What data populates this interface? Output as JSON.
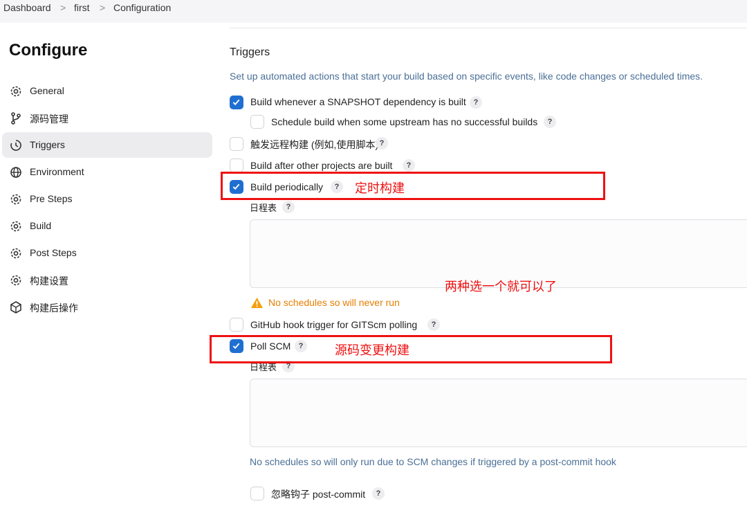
{
  "breadcrumb": {
    "items": [
      "Dashboard",
      "first",
      "Configuration"
    ],
    "separator": ">"
  },
  "page": {
    "title": "Configure"
  },
  "sidebar": {
    "items": [
      {
        "label": "General",
        "icon": "gear-icon",
        "active": false
      },
      {
        "label": "源码管理",
        "icon": "branch-icon",
        "active": false
      },
      {
        "label": "Triggers",
        "icon": "clock-icon",
        "active": true
      },
      {
        "label": "Environment",
        "icon": "globe-icon",
        "active": false
      },
      {
        "label": "Pre Steps",
        "icon": "gear-icon",
        "active": false
      },
      {
        "label": "Build",
        "icon": "gear-icon",
        "active": false
      },
      {
        "label": "Post Steps",
        "icon": "gear-icon",
        "active": false
      },
      {
        "label": "构建设置",
        "icon": "gear-icon",
        "active": false
      },
      {
        "label": "构建后操作",
        "icon": "package-icon",
        "active": false
      }
    ]
  },
  "triggers": {
    "title": "Triggers",
    "description": "Set up automated actions that start your build based on specific events, like code changes or scheduled times.",
    "options": [
      {
        "label": "Build whenever a SNAPSHOT dependency is built",
        "checked": true
      },
      {
        "label": "Schedule build when some upstream has no successful builds",
        "checked": false
      },
      {
        "label": "触发远程构建 (例如,使用脚本)",
        "checked": false
      },
      {
        "label": "Build after other projects are built",
        "checked": false
      },
      {
        "label": "Build periodically",
        "checked": true
      },
      {
        "label": "GitHub hook trigger for GITScm polling",
        "checked": false
      },
      {
        "label": "Poll SCM",
        "checked": true
      },
      {
        "label": "忽略钩子 post-commit",
        "checked": false
      }
    ],
    "help_symbol": "?",
    "schedule_label": "日程表",
    "schedule_value": "",
    "poll_schedule_value": "",
    "warning": "No schedules so will never run",
    "poll_info": "No schedules so will only run due to SCM changes if triggered by a post-commit hook"
  },
  "annotations": {
    "periodic": "定时构建",
    "choose_one": "两种选一个就可以了",
    "scm": "源码变更构建"
  },
  "colors": {
    "accent": "#1f6fd1",
    "warning": "#e67e00",
    "annotation": "#ee1111",
    "info": "#4a6f96"
  }
}
